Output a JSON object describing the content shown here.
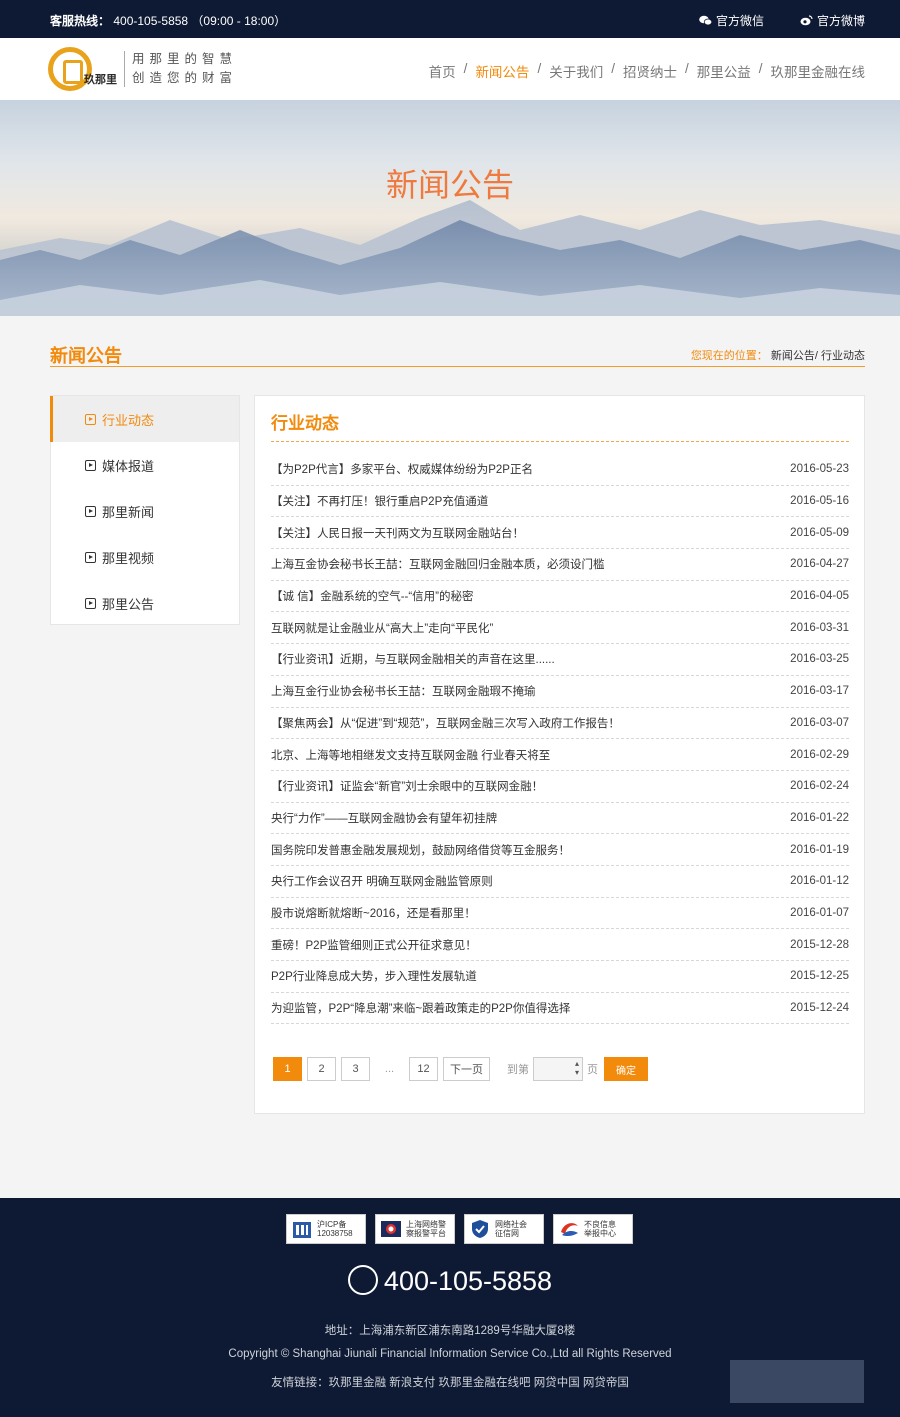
{
  "topbar": {
    "hotline_label": "客服热线：",
    "hotline_value": "400-105-5858 （09:00 - 18:00）",
    "wechat": "官方微信",
    "weibo": "官方微博"
  },
  "header": {
    "logo_name": "玖那里",
    "slogan_line1": "用那里的智慧",
    "slogan_line2": "创造您的财富",
    "nav": [
      {
        "label": "首页",
        "active": false
      },
      {
        "label": "新闻公告",
        "active": true
      },
      {
        "label": "关于我们",
        "active": false
      },
      {
        "label": "招贤纳士",
        "active": false
      },
      {
        "label": "那里公益",
        "active": false
      },
      {
        "label": "玖那里金融在线",
        "active": false
      }
    ],
    "nav_separator": "/"
  },
  "banner": {
    "title": "新闻公告"
  },
  "section": {
    "title": "新闻公告",
    "breadcrumb_label": "您现在的位置：",
    "breadcrumb_path": "新闻公告/ 行业动态"
  },
  "sidebar": {
    "items": [
      {
        "label": "行业动态",
        "active": true
      },
      {
        "label": "媒体报道",
        "active": false
      },
      {
        "label": "那里新闻",
        "active": false
      },
      {
        "label": "那里视频",
        "active": false
      },
      {
        "label": "那里公告",
        "active": false
      }
    ]
  },
  "main": {
    "title": "行业动态",
    "news": [
      {
        "title": "【为P2P代言】多家平台、权威媒体纷纷为P2P正名",
        "date": "2016-05-23"
      },
      {
        "title": "【关注】不再打压！银行重启P2P充值通道",
        "date": "2016-05-16"
      },
      {
        "title": "【关注】人民日报一天刊两文为互联网金融站台！",
        "date": "2016-05-09"
      },
      {
        "title": "上海互金协会秘书长王喆：互联网金融回归金融本质，必须设门槛",
        "date": "2016-04-27"
      },
      {
        "title": "【诚 信】金融系统的空气--“信用”的秘密",
        "date": "2016-04-05"
      },
      {
        "title": "互联网就是让金融业从“高大上”走向“平民化”",
        "date": "2016-03-31"
      },
      {
        "title": "【行业资讯】近期，与互联网金融相关的声音在这里......",
        "date": "2016-03-25"
      },
      {
        "title": "上海互金行业协会秘书长王喆：互联网金融瑕不掩瑜",
        "date": "2016-03-17"
      },
      {
        "title": "【聚焦两会】从“促进”到“规范”，互联网金融三次写入政府工作报告！",
        "date": "2016-03-07"
      },
      {
        "title": "北京、上海等地相继发文支持互联网金融 行业春天将至",
        "date": "2016-02-29"
      },
      {
        "title": "【行业资讯】证监会“新官”刘士余眼中的互联网金融！",
        "date": "2016-02-24"
      },
      {
        "title": "央行“力作”——互联网金融协会有望年初挂牌",
        "date": "2016-01-22"
      },
      {
        "title": "国务院印发普惠金融发展规划，鼓励网络借贷等互金服务！",
        "date": "2016-01-19"
      },
      {
        "title": "央行工作会议召开 明确互联网金融监管原则",
        "date": "2016-01-12"
      },
      {
        "title": "股市说熔断就熔断~2016，还是看那里！",
        "date": "2016-01-07"
      },
      {
        "title": "重磅！P2P监管细则正式公开征求意见！",
        "date": "2015-12-28"
      },
      {
        "title": "P2P行业降息成大势，步入理性发展轨道",
        "date": "2015-12-25"
      },
      {
        "title": "为迎监管，P2P“降息潮”来临~跟着政策走的P2P你值得选择",
        "date": "2015-12-24"
      }
    ],
    "pager": {
      "pages": [
        "1",
        "2",
        "3"
      ],
      "ellipsis": "...",
      "last": "12",
      "next": "下一页",
      "goto_label": "到第",
      "unit": "页",
      "confirm": "确定"
    }
  },
  "footer": {
    "badges": [
      {
        "line1": "沪ICP备",
        "line2": "12038758",
        "icon": "building-icon"
      },
      {
        "line1": "上海网络警",
        "line2": "察报警平台",
        "icon": "police-icon"
      },
      {
        "line1": "网络社会",
        "line2": "征信网",
        "icon": "shield-icon"
      },
      {
        "line1": "不良信息",
        "line2": "举报中心",
        "icon": "report-icon"
      }
    ],
    "phone": "400-105-5858",
    "address": "地址：上海浦东新区浦东南路1289号华融大厦8楼",
    "copyright": "Copyright © Shanghai Jiunali Financial Information Service Co.,Ltd all Rights Reserved",
    "links": "友情链接：玖那里金融 新浪支付 玖那里金融在线吧 网贷中国 网贷帝国"
  },
  "colors": {
    "accent": "#f28a0c",
    "dark": "#0e1a33"
  }
}
